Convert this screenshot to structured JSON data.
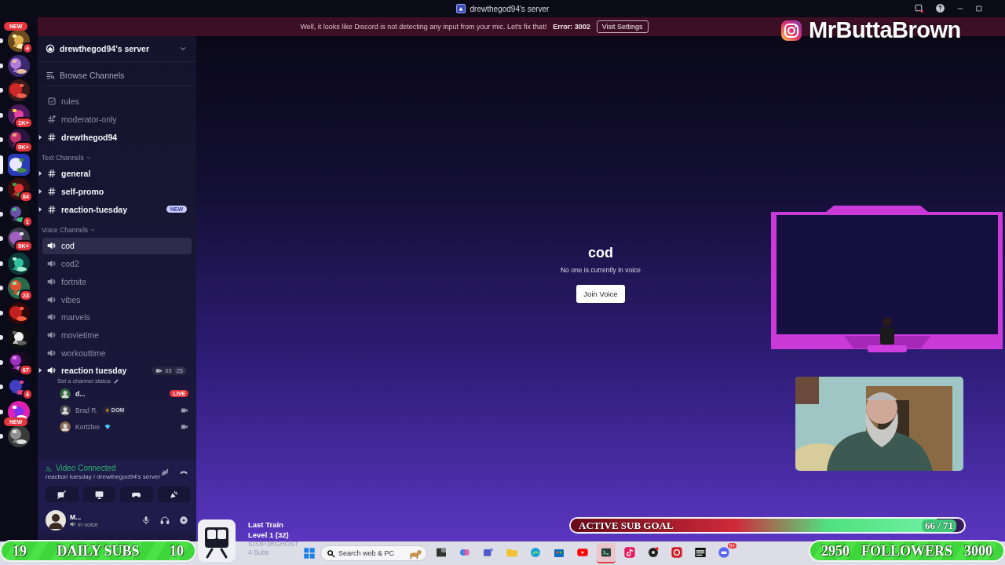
{
  "window": {
    "title": "drewthegod94's server"
  },
  "notice": {
    "message": "Well, it looks like Discord is not detecting any input from your mic. Let's fix that!",
    "error": "Error: 3002",
    "action": "Visit Settings"
  },
  "servers": [
    {
      "pill": "NEW",
      "badge": "4",
      "unread": true,
      "selected": false
    },
    {
      "unread": true,
      "selected": false
    },
    {
      "unread": true,
      "selected": false
    },
    {
      "badge": "1K+",
      "unread": true,
      "selected": false
    },
    {
      "badge": "9K+",
      "unread": true,
      "selected": false
    },
    {
      "unread": false,
      "selected": true
    },
    {
      "badge": "84",
      "unread": true,
      "selected": false
    },
    {
      "badge": "1",
      "unread": true,
      "selected": false
    },
    {
      "badge": "9K+",
      "unread": true,
      "selected": false
    },
    {
      "unread": true,
      "selected": false
    },
    {
      "badge": "23",
      "unread": true,
      "selected": false
    },
    {
      "unread": true,
      "selected": false
    },
    {
      "unread": true,
      "selected": false
    },
    {
      "badge": "67",
      "unread": true,
      "selected": false
    },
    {
      "badge": "4",
      "unread": true,
      "selected": false
    },
    {
      "unread": true,
      "selected": false
    },
    {
      "pill": "NEW",
      "unread": true,
      "selected": false
    }
  ],
  "server": {
    "name": "drewthegod94's server",
    "browse": "Browse Channels"
  },
  "channels": [
    {
      "name": "rules",
      "kind": "rules",
      "unread": false,
      "selected": false
    },
    {
      "name": "moderator-only",
      "kind": "locked",
      "unread": false,
      "selected": false
    },
    {
      "name": "drewthegod94",
      "kind": "text",
      "unread": true,
      "selected": false
    }
  ],
  "categories": [
    {
      "name": "Text Channels",
      "channels": [
        {
          "name": "general",
          "kind": "text",
          "unread": true,
          "selected": false
        },
        {
          "name": "self-promo",
          "kind": "text",
          "unread": true,
          "selected": false
        },
        {
          "name": "reaction-tuesday",
          "kind": "text",
          "unread": true,
          "selected": false,
          "badge": "NEW"
        }
      ]
    },
    {
      "name": "Voice Channels",
      "channels": [
        {
          "name": "cod",
          "kind": "voice",
          "unread": false,
          "selected": true
        },
        {
          "name": "cod2",
          "kind": "voice",
          "unread": false,
          "selected": false
        },
        {
          "name": "fortnite",
          "kind": "voice",
          "unread": false,
          "selected": false
        },
        {
          "name": "vibes",
          "kind": "voice",
          "unread": false,
          "selected": false
        },
        {
          "name": "marvels",
          "kind": "voice",
          "unread": false,
          "selected": false
        },
        {
          "name": "movietime",
          "kind": "voice",
          "unread": false,
          "selected": false
        },
        {
          "name": "workouttime",
          "kind": "voice",
          "unread": false,
          "selected": false
        },
        {
          "name": "reaction tuesday",
          "kind": "voice",
          "unread": true,
          "selected": false,
          "video_count": "05",
          "user_limit": "25",
          "status": "Set a channel status",
          "members": [
            {
              "name": "d...",
              "badge": "LIVE",
              "video": false
            },
            {
              "name": "Brad R.",
              "tag": "DOM",
              "video": true
            },
            {
              "name": "Kortzlee",
              "gem": true,
              "video": true
            }
          ]
        }
      ]
    }
  ],
  "connection": {
    "status": "Video Connected",
    "location": "reaction tuesday / drewthegod94's server"
  },
  "user": {
    "name": "M...",
    "status": "In voice"
  },
  "main": {
    "channel": "cod",
    "message": "No one is currently in voice",
    "button": "Join Voice"
  },
  "taskbar": {
    "search": {
      "placeholder": "Search web & PC"
    },
    "apps": [
      {
        "selected": false
      },
      {
        "selected": false
      },
      {
        "selected": false
      },
      {
        "selected": false
      },
      {
        "selected": false
      },
      {
        "selected": false
      },
      {
        "selected": false
      },
      {
        "selected": true
      },
      {
        "selected": false
      },
      {
        "selected": false
      },
      {
        "selected": false
      },
      {
        "selected": false
      },
      {
        "selected": false,
        "badge": "9+"
      }
    ]
  },
  "overlay": {
    "instagram": "MrButtaBrown",
    "sub_goal": {
      "label": "ACTIVE SUB GOAL",
      "count": "66 / 71",
      "level": 0.93
    },
    "daily_subs": {
      "current": "19",
      "label": "DAILY SUBS",
      "goal": "10"
    },
    "followers": {
      "current": "2950",
      "label": "FOLLOWERS",
      "goal": "3000"
    },
    "last_train": {
      "title": "Last Train",
      "rank": "Level 1 (32)",
      "user": "SI33P3RGHOST",
      "subs": "4 Subs"
    }
  }
}
